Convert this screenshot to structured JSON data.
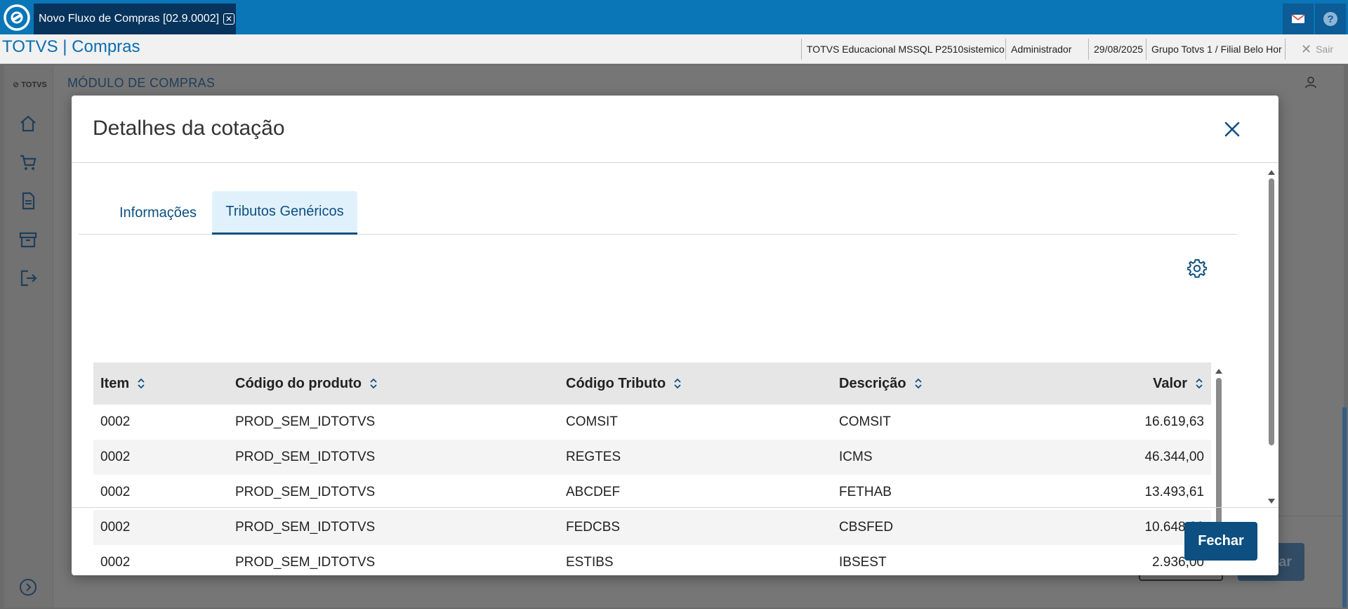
{
  "window": {
    "tab_title": "Novo Fluxo de Compras [02.9.0002]",
    "close_glyph": "✕"
  },
  "header": {
    "brand": "TOTVS | Compras",
    "company": "TOTVS Educacional MSSQL P2510sistemico",
    "user": "Administrador",
    "date": "29/08/2025",
    "branch": "Grupo Totvs 1 / Filial Belo Hor",
    "exit_label": "Sair",
    "exit_glyph": "✕"
  },
  "background": {
    "logo_text": "TOTVS",
    "module_title": "MÓDULO DE COMPRAS",
    "primary_button_fragment": "ar"
  },
  "modal": {
    "title": "Detalhes da cotação",
    "tabs": [
      {
        "label": "Informações",
        "active": false
      },
      {
        "label": "Tributos Genéricos",
        "active": true
      }
    ],
    "columns": {
      "item": "Item",
      "product_code": "Código do produto",
      "tax_code": "Código Tributo",
      "description": "Descrição",
      "value": "Valor"
    },
    "rows": [
      {
        "item": "0002",
        "product_code": "PROD_SEM_IDTOTVS",
        "tax_code": "COMSIT",
        "description": "COMSIT",
        "value": "16.619,63"
      },
      {
        "item": "0002",
        "product_code": "PROD_SEM_IDTOTVS",
        "tax_code": "REGTES",
        "description": "ICMS",
        "value": "46.344,00"
      },
      {
        "item": "0002",
        "product_code": "PROD_SEM_IDTOTVS",
        "tax_code": "ABCDEF",
        "description": "FETHAB",
        "value": "13.493,61"
      },
      {
        "item": "0002",
        "product_code": "PROD_SEM_IDTOTVS",
        "tax_code": "FEDCBS",
        "description": "CBSFED",
        "value": "10.648,00"
      },
      {
        "item": "0002",
        "product_code": "PROD_SEM_IDTOTVS",
        "tax_code": "ESTIBS",
        "description": "IBSEST",
        "value": "2.936,00"
      }
    ],
    "close_button_label": "Fechar"
  },
  "colors": {
    "titlebar": "#0a76b8",
    "tab_active_bg": "#e1f1fc",
    "primary": "#0c4f80",
    "brand": "#0c6db3"
  },
  "icons": {
    "app_logo": "totvs-logo-icon",
    "mail": "mail-icon",
    "help": "help-icon",
    "modal_close": "close-icon",
    "settings": "gear-icon",
    "sort": "sort-icon",
    "sidebar": [
      "home-icon",
      "cart-icon",
      "document-icon",
      "archive-icon",
      "logout-icon",
      "expand-icon"
    ]
  }
}
